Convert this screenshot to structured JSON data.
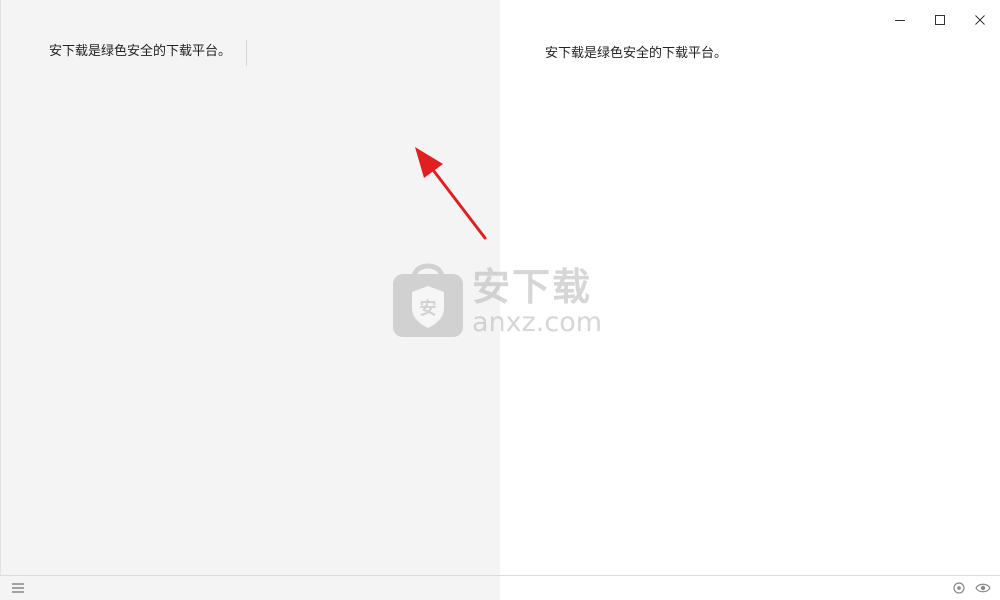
{
  "editor": {
    "text": "安下载是绿色安全的下载平台。"
  },
  "preview": {
    "text": "安下载是绿色安全的下载平台。"
  },
  "window_controls": {
    "minimize": "minimize-icon",
    "maximize": "maximize-icon",
    "close": "close-icon"
  },
  "statusbar": {
    "menu_icon": "hamburger-menu-icon",
    "settings_icon": "target-icon",
    "preview_icon": "eye-icon"
  },
  "watermark": {
    "bag_char": "安",
    "cn": "安下载",
    "en": "anxz.com"
  },
  "colors": {
    "editor_bg": "#f4f4f4",
    "preview_bg": "#ffffff",
    "arrow": "#e02020",
    "watermark": "#b5b5b5"
  }
}
